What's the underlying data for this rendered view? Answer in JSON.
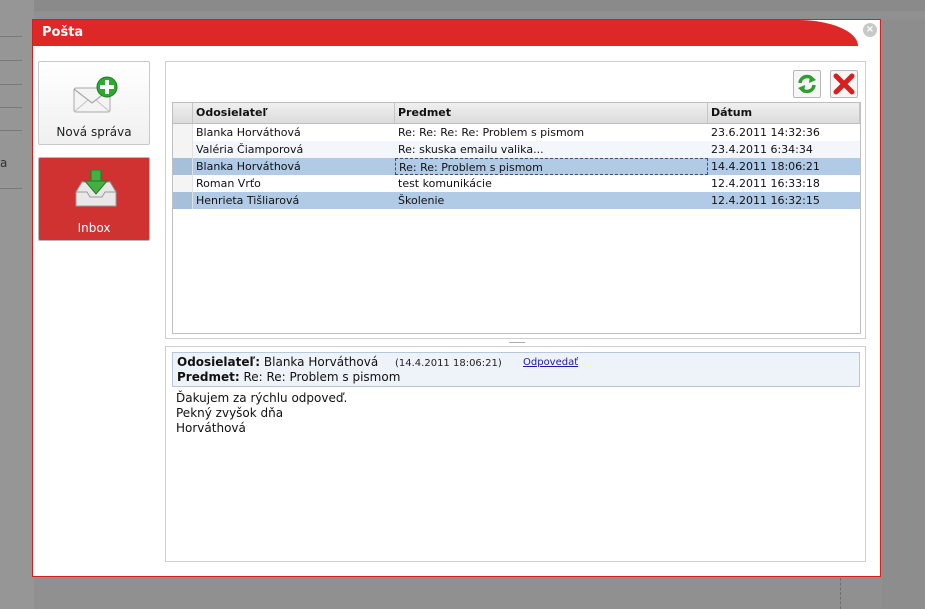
{
  "background": {
    "side_text": "a"
  },
  "dialog": {
    "title": "Pošta",
    "close_label": "×"
  },
  "nav": {
    "new_message": "Nová správa",
    "inbox": "Inbox"
  },
  "toolbar": {
    "refresh_icon": "refresh-icon",
    "delete_icon": "delete-icon"
  },
  "grid": {
    "columns": [
      "Odosielateľ",
      "Predmet",
      "Dátum"
    ],
    "rows": [
      {
        "sender": "Blanka Horváthová",
        "subject": "Re: Re: Re: Re: Problem s pismom",
        "date": "23.6.2011 14:32:36"
      },
      {
        "sender": "Valéria Čiamporová",
        "subject": "Re: skuska emailu valika...",
        "date": "23.4.2011 6:34:34"
      },
      {
        "sender": "Blanka Horváthová",
        "subject": "Re: Re: Problem s pismom",
        "date": "14.4.2011 18:06:21"
      },
      {
        "sender": "Roman Vrťo",
        "subject": "test komunikácie",
        "date": "12.4.2011 16:33:18"
      },
      {
        "sender": "Henrieta Tišliarová",
        "subject": "Školenie",
        "date": "12.4.2011 16:32:15"
      }
    ]
  },
  "preview": {
    "sender_label": "Odosielateľ:",
    "sender": "Blanka Horváthová",
    "date": "(14.4.2011 18:06:21)",
    "reply": "Odpovedať",
    "subject_label": "Predmet:",
    "subject": "Re: Re: Problem s pismom",
    "body": [
      "Ďakujem za rýchlu odpoveď.",
      "Pekný zvyšok dňa",
      "Horváthová"
    ]
  },
  "colors": {
    "accent": "#de2727",
    "selected_row": "#b1cbe6"
  }
}
